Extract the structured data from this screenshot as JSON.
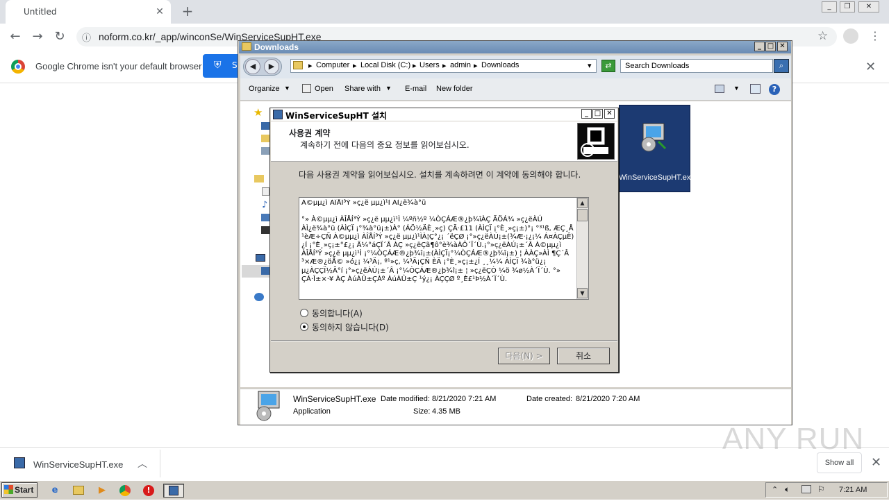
{
  "browser": {
    "tab_title": "Untitled",
    "tab_close": "✕",
    "new_tab": "+",
    "url": "noform.co.kr/_app/winconSe/WinServiceSupHT.exe",
    "infobar_text": "Google Chrome isn't your default browser",
    "infobar_button": "S",
    "infobar_close": "✕"
  },
  "explorer": {
    "title": "Downloads",
    "breadcrumbs": [
      "Computer",
      "Local Disk (C:)",
      "Users",
      "admin",
      "Downloads"
    ],
    "search_placeholder": "Search Downloads",
    "commands": {
      "organize": "Organize",
      "open": "Open",
      "share_with": "Share with",
      "email": "E-mail",
      "new_folder": "New folder"
    },
    "file_name": "WinServiceSupHT.exe",
    "details": {
      "name": "WinServiceSupHT.exe",
      "type": "Application",
      "date_modified_label": "Date modified:",
      "date_modified": "8/21/2020 7:21 AM",
      "date_created_label": "Date created:",
      "date_created": "8/21/2020 7:20 AM",
      "size_label": "Size:",
      "size": "4.35 MB"
    }
  },
  "installer": {
    "title": "WinServiceSupHT 설치",
    "heading": "사용권 계약",
    "subheading": "계속하기 전에 다음의 중요 정보를 읽어보십시오.",
    "instruction": "다음 사용권 계약을 읽어보십시오. 설치를 계속하려면 이 계약에 동의해야 합니다.",
    "license_text": "À©µµ¿ì ÀÎÅÍ³Ý »ç¿ë µµ¿ì¹Ì ÀÌ¿ë¾à°ü\n\n°» À©µµ¿ì ÀÎÅÍ³Ý »ç¿ë µµ¿ì¹Ì ¼­ºñ½º ¼ÒÇÁÆ®¿þ¾îÀÇ ÃÖÁ¾ »ç¿ëÀÚ ÀÌ¿ë¾à°ü (ÀÌÇÏ ¡°¾à°ü¡±)À° (ÁÖ½ÄÈ¸»ç) ÇÃ·£11 (ÀÌÇÏ ¡°È¸»ç¡±)°¡ °³¹ß, ÆÇ¸Å ¹èÆ÷ÇÑ À©µµ¿ì ÀÎÅÍ³Ý »ç¿ë µµ¿ì¹ÌÀ¦Ç°¿¡ ´ëÇØ ¡°»ç¿ëÀÚ¡±(¾Æ·¡¿¡¼­ Á¤ÀÇµÊ) ¿Í ¡°È¸»ç¡±°£¿¡ Ã¼°áÇÏ´Â ÀÇ »ç¿ëÇã¶ô°è¾àÀÔ´Ï´Ù.¡°»ç¿ëÀÚ¡±´Â À©µµ¿ì ÀÎÅÍ³Ý »ç¿ë µµ¿ì¹Ì ¡°¼ÒÇÁÆ®¿þ¾î¡±(ÀÌÇÏ¡°¼ÒÇÁÆ®¿þ¾î¡±) ¦ ÀÀÇ»ÀÌ ¶Ç´Â ³×Æ®¿öÅ© »ó¿¡ ¼³Ä¡, º¹»ç, ¼³Ä¡ÇÑ ÈÄ ¡°È¸»ç¡±¿Í ¸¸¼¼ ÀÌÇÏ ¾à°ü¿¡ µ¿ÀÇÇÏ½Ã°í ¡°»ç¿ëÀÚ¡±´Â ¡°¼ÒÇÁÆ®¿þ¾î¡± ¦ »ç¿ëÇÒ ¼ö ¾ø½À´Ï´Ù. °» ÇÁ·Î±×·¥ ÀÇ ÀúÀÛ±ÇÀº ÀúÀÛ±Ç ¹ý¿¡ ÀÇÇØ º¸È£¹Þ½À´Ï´Ù.",
    "radio_accept": "동의합니다(A)",
    "radio_decline": "동의하지 않습니다(D)",
    "next_button": "다음(N) >",
    "cancel_button": "취소"
  },
  "download_bar": {
    "file_name": "WinServiceSupHT.exe",
    "show_all": "Show all",
    "close": "✕"
  },
  "watermark": "ANY RUN",
  "taskbar": {
    "start": "Start",
    "clock": "7:21 AM"
  }
}
